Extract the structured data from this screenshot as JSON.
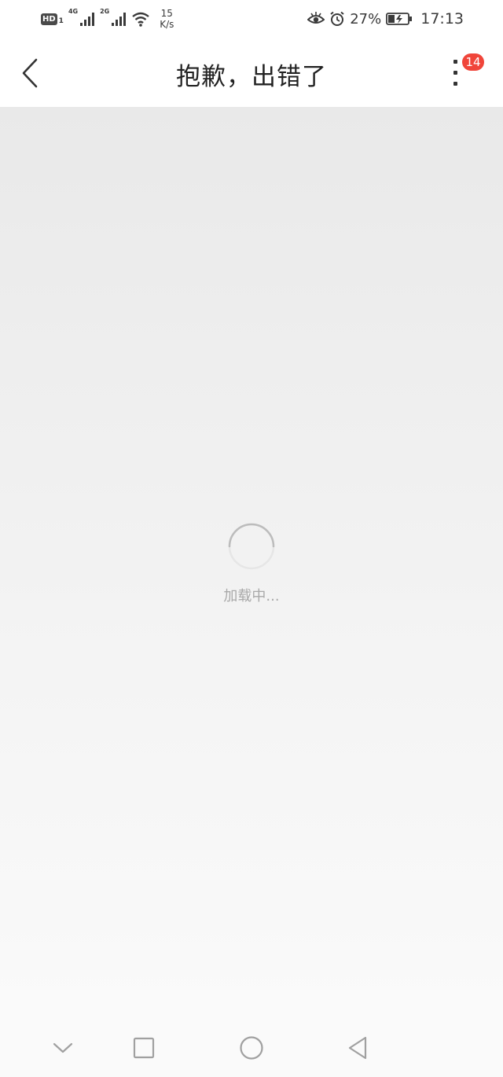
{
  "status_bar": {
    "hd_label": "HD",
    "sim_number": "1",
    "net_primary": "4G",
    "net_secondary": "2G",
    "speed_value": "15",
    "speed_unit": "K/s",
    "battery_percent": "27%",
    "time": "17:13",
    "icons": [
      "eye-icon",
      "alarm-icon",
      "battery-charging-icon",
      "wifi-icon",
      "signal-icon"
    ]
  },
  "header": {
    "title": "抱歉，出错了",
    "notification_count": "14"
  },
  "main": {
    "loading_text": "加载中..."
  },
  "colors": {
    "badge": "#f0453a",
    "title_text": "#222222",
    "loading_text": "#a9a9a9",
    "content_bg_top": "#e9e9e9",
    "content_bg_bottom": "#fafafa"
  },
  "nav": {
    "icons": [
      "chevron-down-icon",
      "square-icon",
      "circle-icon",
      "triangle-back-icon"
    ]
  }
}
